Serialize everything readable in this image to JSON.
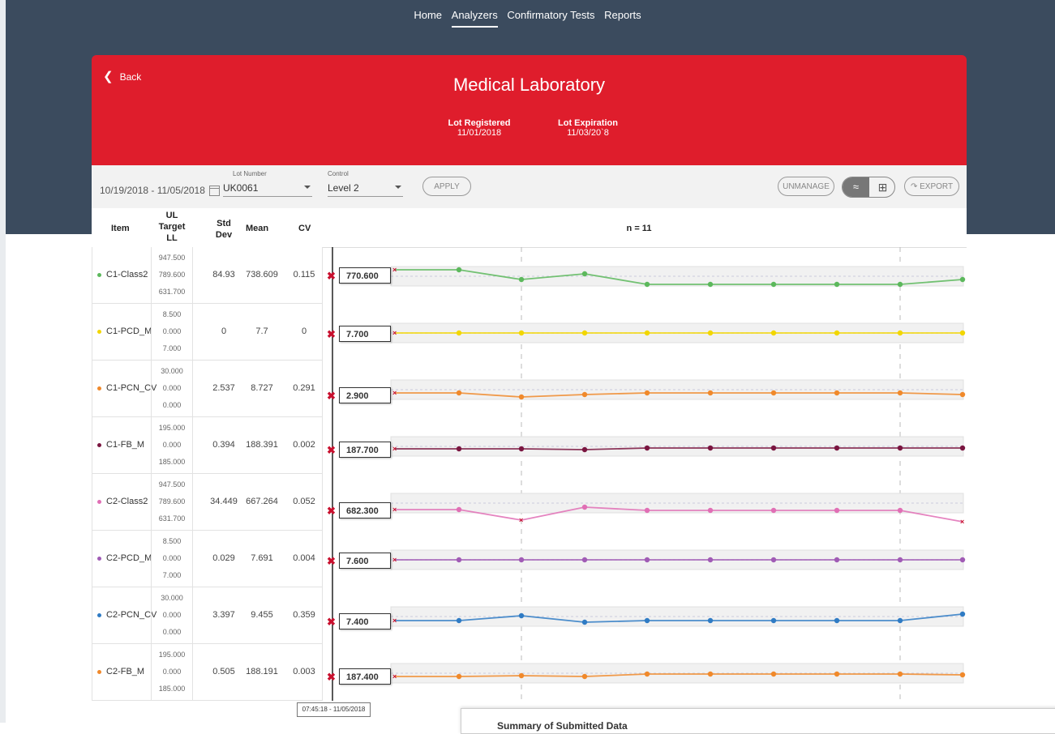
{
  "nav": {
    "items": [
      "Home",
      "Analyzers",
      "Confirmatory Tests",
      "Reports"
    ],
    "active": "Analyzers"
  },
  "header": {
    "back_label": "Back",
    "title": "Medical Laboratory",
    "lot_registered_label": "Lot Registered",
    "lot_registered_value": "11/01/2018",
    "lot_expiration_label": "Lot Expiration",
    "lot_expiration_value": "11/03/20`8"
  },
  "filters": {
    "date_range": "10/19/2018 - 11/05/2018",
    "lot_number_label": "Lot Number",
    "lot_number_value": "UK0061",
    "control_label": "Control",
    "control_value": "Level 2",
    "apply_label": "APPLY",
    "unmanage_label": "UNMANAGE",
    "export_label": "EXPORT"
  },
  "table": {
    "headers": {
      "item": "Item",
      "limits": [
        "UL",
        "Target",
        "LL"
      ],
      "std_dev": "Std Dev",
      "mean": "Mean",
      "cv": "CV",
      "n": "n = 11"
    },
    "rows": [
      {
        "item": "C1-Class2",
        "color": "#5cb85c",
        "ul": "947.500",
        "target": "789.600",
        "ll": "631.700",
        "std": "84.93",
        "mean": "738.609",
        "cv": "0.115",
        "last": "770.600"
      },
      {
        "item": "C1-PCD_M",
        "color": "#f2d600",
        "ul": "8.500",
        "target": "0.000",
        "ll": "7.000",
        "std": "0",
        "mean": "7.7",
        "cv": "0",
        "last": "7.700"
      },
      {
        "item": "C1-PCN_CV",
        "color": "#f0892b",
        "ul": "30.000",
        "target": "0.000",
        "ll": "0.000",
        "std": "2.537",
        "mean": "8.727",
        "cv": "0.291",
        "last": "2.900"
      },
      {
        "item": "C1-FB_M",
        "color": "#7a1540",
        "ul": "195.000",
        "target": "0.000",
        "ll": "185.000",
        "std": "0.394",
        "mean": "188.391",
        "cv": "0.002",
        "last": "187.700"
      },
      {
        "item": "C2-Class2",
        "color": "#e06fb5",
        "ul": "947.500",
        "target": "789.600",
        "ll": "631.700",
        "std": "34.449",
        "mean": "667.264",
        "cv": "0.052",
        "last": "682.300"
      },
      {
        "item": "C2-PCD_M",
        "color": "#a05bb5",
        "ul": "8.500",
        "target": "0.000",
        "ll": "7.000",
        "std": "0.029",
        "mean": "7.691",
        "cv": "0.004",
        "last": "7.600"
      },
      {
        "item": "C2-PCN_CV",
        "color": "#2f7bc4",
        "ul": "30.000",
        "target": "0.000",
        "ll": "0.000",
        "std": "3.397",
        "mean": "9.455",
        "cv": "0.359",
        "last": "7.400"
      },
      {
        "item": "C2-FB_M",
        "color": "#f0892b",
        "ul": "195.000",
        "target": "0.000",
        "ll": "185.000",
        "std": "0.505",
        "mean": "188.191",
        "cv": "0.003",
        "last": "187.400"
      }
    ]
  },
  "tooltip": "07:45:18 - 11/05/2018",
  "summary_title": "Summary of Submitted Data"
}
